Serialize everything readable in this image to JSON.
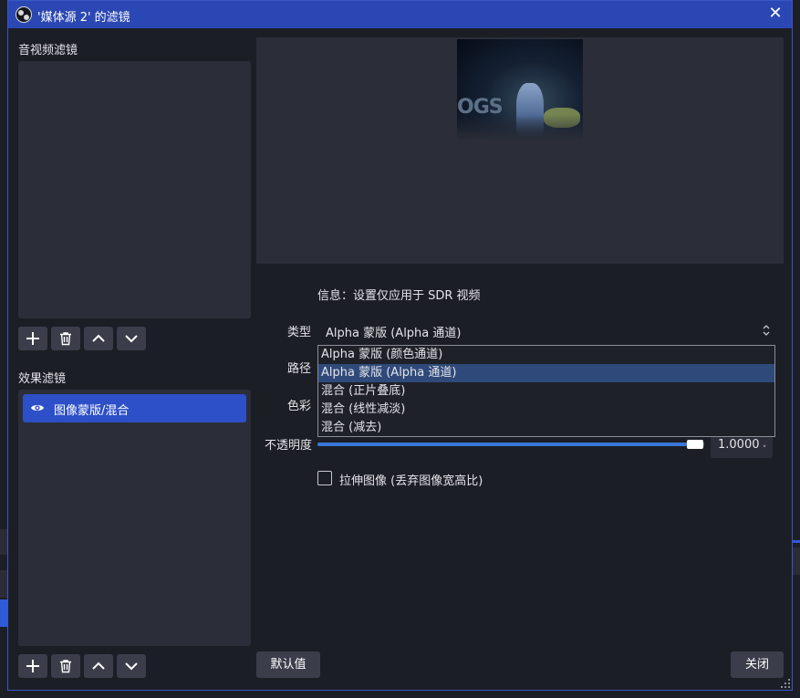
{
  "window": {
    "title": "'媒体源 2' 的滤镜",
    "close_icon": "close-icon"
  },
  "audio_video_filters": {
    "label": "音视频滤镜"
  },
  "effect_filters": {
    "label": "效果滤镜",
    "items": [
      {
        "label": "图像蒙版/混合",
        "visible": true
      }
    ]
  },
  "toolbar_icons": [
    "plus-icon",
    "trash-icon",
    "chevron-up-icon",
    "chevron-down-icon"
  ],
  "properties": {
    "info": "信息：设置仅应用于 SDR 视频",
    "type_label": "类型",
    "type_value": "Alpha 蒙版 (Alpha 通道)",
    "path_label": "路径",
    "color_label": "色彩",
    "opacity_label": "不透明度",
    "opacity_value": "1.0000",
    "opacity_fraction": 1.0,
    "stretch_label": "拉伸图像 (丢弃图像宽高比)",
    "stretch_checked": false
  },
  "type_dropdown": {
    "options": [
      "Alpha 蒙版 (颜色通道)",
      "Alpha 蒙版 (Alpha 通道)",
      "混合 (正片叠底)",
      "混合 (线性减淡)",
      "混合 (减去)"
    ],
    "selected_index": 1
  },
  "buttons": {
    "defaults": "默认值",
    "close": "关闭"
  },
  "colors": {
    "titlebar": "#2b47b3",
    "selected_filter": "#2d50c8",
    "panel": "#2b2e38",
    "window_bg": "#1c1e26",
    "slider": "#3a78d8"
  }
}
